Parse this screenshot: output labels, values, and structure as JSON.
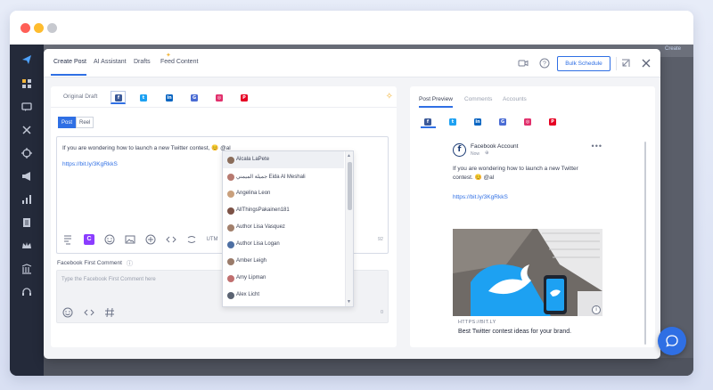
{
  "colors": {
    "accent": "#2f6fe4",
    "window_dot_red": "#ff5f57",
    "window_dot_yellow": "#febc2e",
    "window_dot_gray": "#c7c9cf",
    "facebook": "#3b5998",
    "twitter": "#1da1f2",
    "linkedin": "#0a66c2",
    "google_business": "#4a6cd4",
    "instagram": "#e1306c",
    "pinterest": "#e60023"
  },
  "background": {
    "top_button_label": "Create"
  },
  "sidebar": {
    "icons": [
      "send-icon",
      "dashboard-icon",
      "inbox-icon",
      "tools-icon",
      "target-icon",
      "megaphone-icon",
      "analytics-icon",
      "reports-icon",
      "crown-icon",
      "library-icon",
      "headset-icon"
    ]
  },
  "modal": {
    "tabs": [
      {
        "label": "Create Post",
        "active": true
      },
      {
        "label": "AI Assistant",
        "active": false
      },
      {
        "label": "Drafts",
        "active": false
      },
      {
        "label": "Feed Content",
        "active": false
      }
    ],
    "header_icons": [
      "video-icon",
      "help-icon",
      "collapse-icon",
      "close-icon"
    ],
    "bulk_schedule_label": "Bulk Schedule"
  },
  "composer": {
    "original_draft_label": "Original Draft",
    "networks": [
      "facebook",
      "twitter",
      "linkedin",
      "google-business",
      "instagram",
      "pinterest"
    ],
    "active_network": "facebook",
    "post_type_options": [
      "Post",
      "Reel"
    ],
    "selected_post_type": "Post",
    "text_line": "If you are wondering how to launch a new Twitter contest, 😊 @al",
    "link": "https://bit.ly/3KgRkkS",
    "toolbar_icons": [
      "text-format-icon",
      "canva-icon",
      "emoji-icon",
      "media-icon",
      "gif-icon",
      "code-icon",
      "hashtag-icon"
    ],
    "toolbar_utm": "UTM",
    "char_count": "92",
    "canva_letter": "C"
  },
  "mention_dropdown": {
    "items": [
      {
        "name": "Alcala LaPete",
        "avatar_color": "#8a6d5a"
      },
      {
        "name": "جميلة الميمني Eida Al Meshali",
        "avatar_color": "#b77a70"
      },
      {
        "name": "Angelina Leon",
        "avatar_color": "#c9a07c"
      },
      {
        "name": "AllThingsPakainen181",
        "avatar_color": "#7c5246"
      },
      {
        "name": "Author Lisa Vasquez",
        "avatar_color": "#a2806c"
      },
      {
        "name": "Author Lisa Logan",
        "avatar_color": "#4d6fa3"
      },
      {
        "name": "Amber Leigh",
        "avatar_color": "#9a7b6a"
      },
      {
        "name": "Amy Lipman",
        "avatar_color": "#c06f6f"
      },
      {
        "name": "Alex Licht",
        "avatar_color": "#5b6372"
      }
    ]
  },
  "first_comment": {
    "label": "Facebook First Comment",
    "placeholder": "Type the Facebook First Comment here",
    "icons": [
      "emoji-icon",
      "code-icon",
      "hashtag-icon"
    ],
    "count": "0"
  },
  "preview": {
    "tabs": [
      {
        "label": "Post Preview",
        "active": true
      },
      {
        "label": "Comments",
        "active": false
      },
      {
        "label": "Accounts",
        "active": false
      }
    ],
    "networks": [
      "facebook",
      "twitter",
      "linkedin",
      "google-business",
      "instagram",
      "pinterest"
    ],
    "card": {
      "account_name": "Facebook Account",
      "time": "Now",
      "text": "If you are wondering how to launch a new Twitter contest. 😊 @al",
      "link": "https://bit.ly/3KgRkkS",
      "link_domain": "HTTPS://BIT.LY",
      "link_headline": "Best Twitter contest ideas for your brand."
    }
  },
  "chat_button": {
    "icon": "chat-icon"
  }
}
